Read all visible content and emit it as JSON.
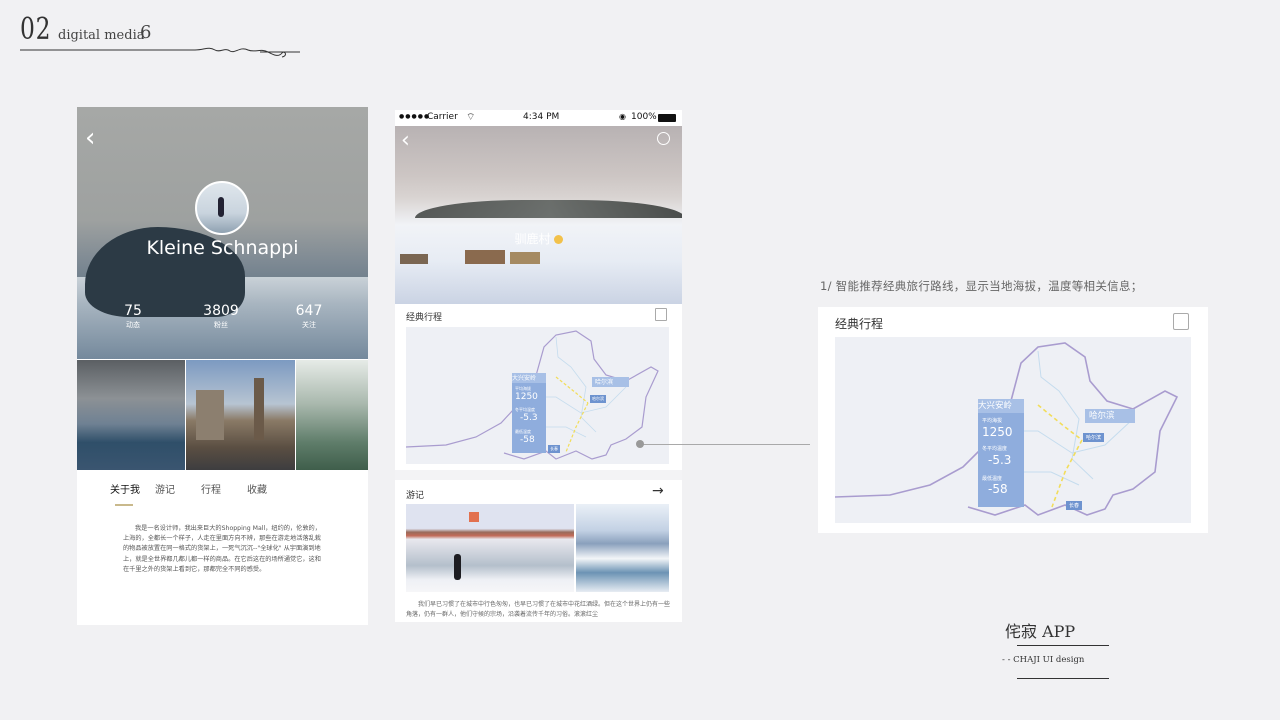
{
  "header": {
    "num": "02",
    "subtitle": "digital media",
    "page": "6"
  },
  "profile": {
    "name": "Kleine Schnappi",
    "stats": [
      {
        "value": "75",
        "label": "动态"
      },
      {
        "value": "3809",
        "label": "粉丝"
      },
      {
        "value": "647",
        "label": "关注"
      }
    ],
    "tabs": [
      "关于我",
      "游记",
      "行程",
      "收藏"
    ],
    "active_tab": "关于我",
    "about": "我是一名设计师，我出来巨大的Shopping Mall，纽约的，伦敦的，上海的，全都长一个样子，人走在里面方向不辨，那些在游走地活落乱栽的物品被放置在同一格式的货架上，一死气沉沉--\"全球化\" 从宇面演到地上，就是全世界都几都儿都一样的商品。在它后这在的场所通觉它，这和在千里之外的货架上看到它，那都完全不同的感受。"
  },
  "detail": {
    "status": {
      "carrier": "Carrier",
      "time": "4:34 PM",
      "battery": "100%"
    },
    "hero_title": "驯鹿村",
    "itinerary": {
      "title": "经典行程",
      "region": "大兴安岭",
      "city": "哈尔滨",
      "small_city": "长春",
      "small_tag": "哈尔滨",
      "altitude_label": "平均海拔",
      "altitude": "1250",
      "temp_avg_label": "冬平均温度",
      "temp_avg": "-5.3",
      "temp_low_label": "最低温度",
      "temp_low": "-58"
    },
    "travelogue": {
      "title": "游记",
      "text": "我们早已习惯了在城市中行色匆匆，也早已习惯了在城市中花红酒绿。但在这个世界上仍有一些角落，仍有一群人，他们守候的宗场，沿袭着流传千年的习俗。滚滚红尘"
    }
  },
  "note": "1/  智能推荐经典旅行路线，显示当地海拔，温度等相关信息；",
  "brand": {
    "name": "侘寂 APP",
    "sub": "- - CHAJI UI design"
  },
  "colors": {
    "map_line": "#a99ccf",
    "info_panel": "#8faddd",
    "route": "#f2dd5a",
    "underline": "#c9b98c"
  }
}
